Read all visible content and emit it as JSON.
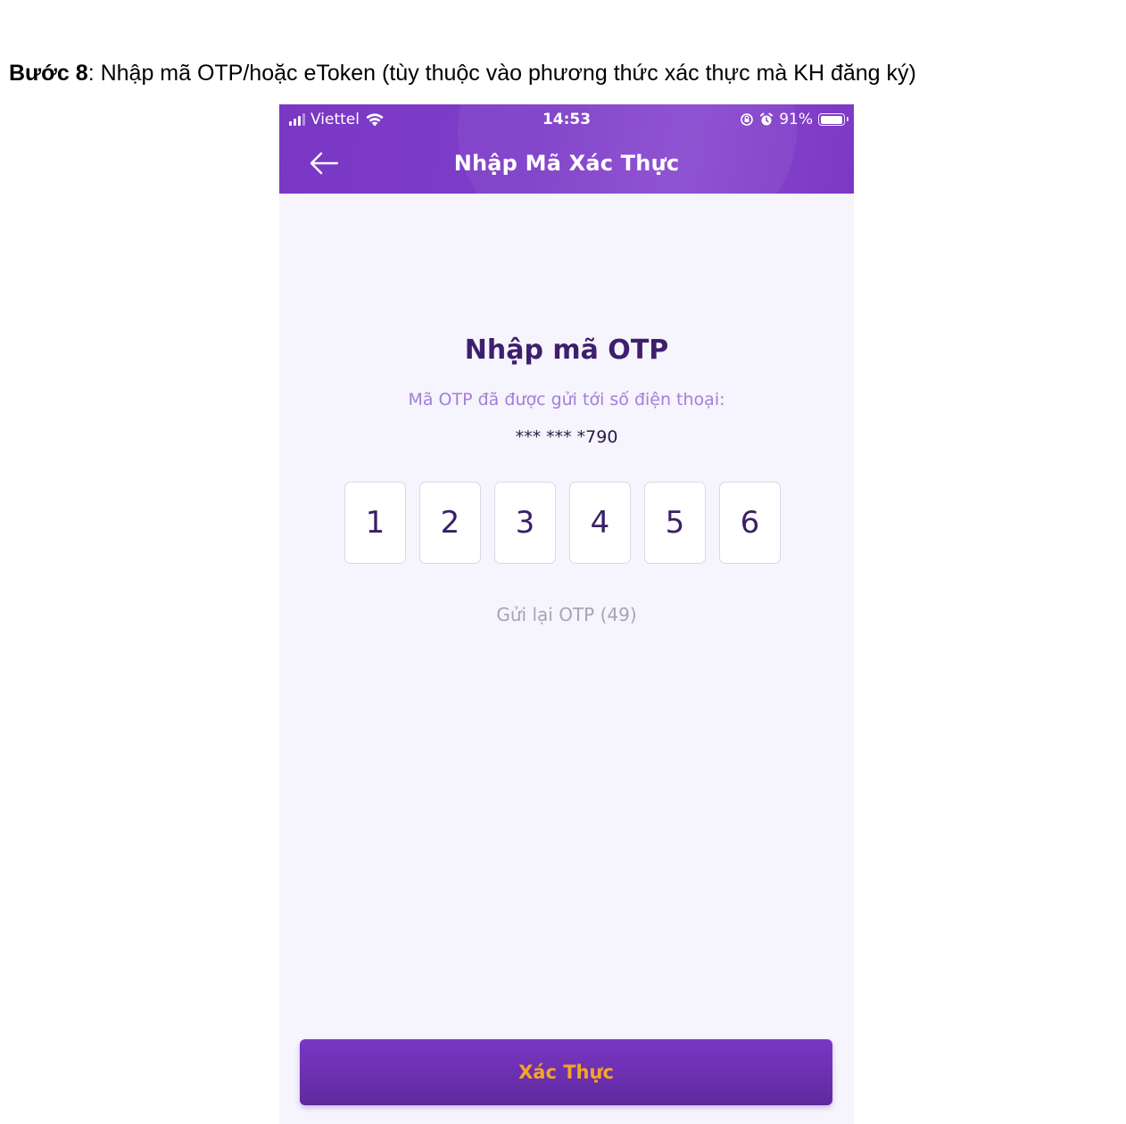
{
  "document": {
    "step_label": "Bước 8",
    "step_text": ": Nhập mã OTP/hoặc eToken (tùy thuộc vào phương thức xác thực mà KH đăng ký)"
  },
  "status_bar": {
    "carrier": "Viettel",
    "time": "14:53",
    "battery": "91%"
  },
  "header": {
    "title": "Nhập Mã Xác Thực",
    "back_icon": "arrow-left-icon"
  },
  "otp": {
    "title": "Nhập mã OTP",
    "subtitle": "Mã OTP đã được gửi tới số điện thoại:",
    "phone_mask": "*** *** *790",
    "digits": [
      "1",
      "2",
      "3",
      "4",
      "5",
      "6"
    ],
    "resend_label": "Gửi lại OTP (49)"
  },
  "actions": {
    "verify_label": "Xác Thực"
  },
  "colors": {
    "header_purple": "#7b3ac6",
    "title_purple": "#3d1f6b",
    "subtitle_purple": "#a37fd6",
    "button_text_orange": "#f5a623",
    "background": "#f6f4fd"
  }
}
